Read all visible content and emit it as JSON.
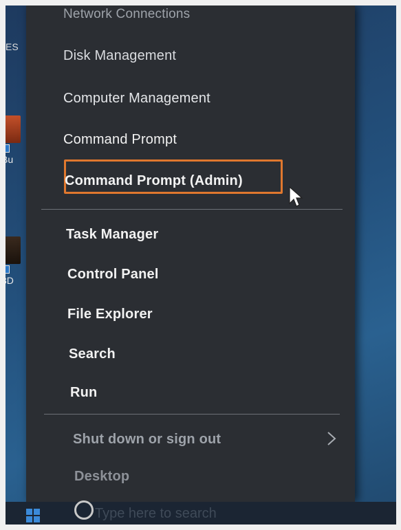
{
  "menu": {
    "items": [
      {
        "label": "Network Connections"
      },
      {
        "label": "Disk Management"
      },
      {
        "label": "Computer Management"
      },
      {
        "label": "Command Prompt"
      },
      {
        "label": "Command Prompt (Admin)"
      },
      {
        "label": "Task Manager"
      },
      {
        "label": "Control Panel"
      },
      {
        "label": "File Explorer"
      },
      {
        "label": "Search"
      },
      {
        "label": "Run"
      },
      {
        "label": "Shut down or sign out"
      },
      {
        "label": "Desktop"
      }
    ]
  },
  "taskbar": {
    "search_placeholder": "Type here to search"
  },
  "desktop": {
    "edge_text": "ES",
    "icon1_label": "Bu",
    "icon2_label": "3D"
  },
  "colors": {
    "menu_bg": "#2b2e33",
    "highlight": "#e0782e",
    "desktop": "#23507c"
  },
  "icons": [
    "chevron-right-icon",
    "mouse-cursor-icon",
    "windows-logo-icon",
    "search-icon",
    "shortcut-arrow-icon"
  ]
}
